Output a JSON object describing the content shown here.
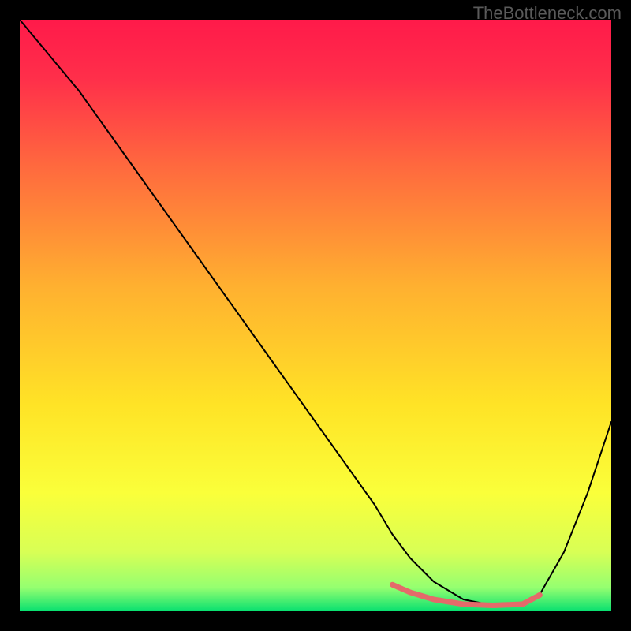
{
  "watermark": "TheBottleneck.com",
  "chart_data": {
    "type": "line",
    "title": "",
    "xlabel": "",
    "ylabel": "",
    "xlim": [
      0,
      100
    ],
    "ylim": [
      0,
      100
    ],
    "grid": false,
    "legend": false,
    "background_gradient": {
      "stops": [
        {
          "offset": 0.0,
          "color": "#ff1a4a"
        },
        {
          "offset": 0.1,
          "color": "#ff2f4a"
        },
        {
          "offset": 0.25,
          "color": "#ff6a3e"
        },
        {
          "offset": 0.45,
          "color": "#ffb030"
        },
        {
          "offset": 0.65,
          "color": "#ffe326"
        },
        {
          "offset": 0.8,
          "color": "#faff3a"
        },
        {
          "offset": 0.9,
          "color": "#d8ff55"
        },
        {
          "offset": 0.96,
          "color": "#95ff70"
        },
        {
          "offset": 1.0,
          "color": "#08e070"
        }
      ]
    },
    "series": [
      {
        "name": "bottleneck-curve",
        "color": "#000000",
        "stroke_width": 2,
        "x": [
          0,
          5,
          10,
          15,
          20,
          25,
          30,
          35,
          40,
          45,
          50,
          55,
          60,
          63,
          66,
          70,
          75,
          80,
          85,
          88,
          92,
          96,
          100
        ],
        "y": [
          100,
          94,
          88,
          81,
          74,
          67,
          60,
          53,
          46,
          39,
          32,
          25,
          18,
          13,
          9,
          5,
          2,
          1,
          1,
          3,
          10,
          20,
          32
        ]
      },
      {
        "name": "optimal-range-marker",
        "color": "#e46a6a",
        "stroke_width": 7,
        "dash": true,
        "x": [
          63,
          66,
          70,
          75,
          80,
          85,
          88
        ],
        "y": [
          4.5,
          3.2,
          2.0,
          1.2,
          1.0,
          1.2,
          2.8
        ]
      }
    ]
  }
}
